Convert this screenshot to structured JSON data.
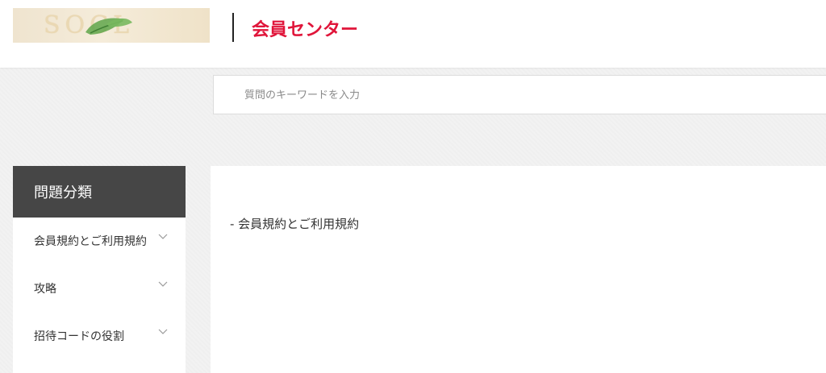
{
  "header": {
    "logo_text": "SOCL",
    "title": "会員センター"
  },
  "search": {
    "placeholder": "質問のキーワードを入力"
  },
  "sidebar": {
    "heading": "問題分類",
    "items": [
      {
        "label": "会員規約とご利用規約",
        "icon": "chevron-down-icon"
      },
      {
        "label": "攻略",
        "icon": "chevron-down-icon"
      },
      {
        "label": "招待コードの役割",
        "icon": "chevron-down-icon"
      }
    ]
  },
  "content": {
    "heading": "- 会員規約とご利用規約"
  },
  "colors": {
    "accent": "#e0153a",
    "sidebar_header_bg": "#464646"
  }
}
